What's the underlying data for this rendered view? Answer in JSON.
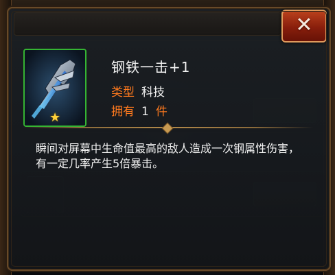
{
  "popup": {
    "close_icon": "✕",
    "close_icon_name": "close-icon"
  },
  "item": {
    "name": "钢铁一击+1",
    "type_label": "类型",
    "type_value": "科技",
    "own_label": "拥有",
    "own_count": "1",
    "own_unit": "件",
    "stars": 1,
    "description": "瞬间对屏幕中生命值最高的敌人造成一次钢属性伤害，有一定几率产生5倍暴击。"
  },
  "colors": {
    "accent_orange": "#ff7a1e",
    "rarity_green": "#35b533",
    "close_red": "#c2441e",
    "frame_gold": "#6b4c2a"
  }
}
